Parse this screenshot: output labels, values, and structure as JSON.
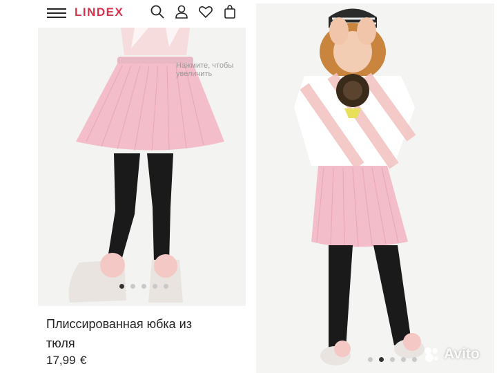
{
  "header": {
    "brand": "LINDEX",
    "icons": [
      "menu-icon",
      "search-icon",
      "account-icon",
      "heart-icon",
      "bag-icon"
    ]
  },
  "gallery": {
    "zoom_hint": "Нажмите, чтобы увеличить",
    "dots_count": 5,
    "active_dot": 1
  },
  "product": {
    "name": "Плиссированная юбка из тюля",
    "price": "17,99",
    "currency": "€"
  },
  "second_photo": {
    "dots_count": 5,
    "active_dot": 2
  },
  "watermark": {
    "text": "Avito"
  },
  "colors": {
    "brand": "#d6324a",
    "skirt": "#f3bdc9",
    "tights": "#1a1a1a",
    "stripe_pink": "#f2c5c2",
    "lollipop": "#3a2a1a"
  }
}
